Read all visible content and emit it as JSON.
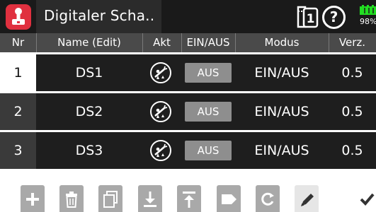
{
  "header": {
    "title": "Digitaler Scha..",
    "app_icon": "joystick-switch-icon",
    "model_icon": "model-memory-icon",
    "model_number": "1",
    "help_label": "?",
    "battery_percent": "98%",
    "accent_color": "#e0303f",
    "battery_color": "#22dd22"
  },
  "table": {
    "columns": [
      "Nr",
      "Name (Edit)",
      "Akt",
      "EIN/AUS",
      "Modus",
      "Verz."
    ],
    "rows": [
      {
        "nr": "1",
        "name": "DS1",
        "akt_icon": "control-assign-icon",
        "switch": "AUS",
        "mode": "EIN/AUS",
        "delay": "0.5"
      },
      {
        "nr": "2",
        "name": "DS2",
        "akt_icon": "control-assign-icon",
        "switch": "AUS",
        "mode": "EIN/AUS",
        "delay": "0.5"
      },
      {
        "nr": "3",
        "name": "DS3",
        "akt_icon": "control-assign-icon",
        "switch": "AUS",
        "mode": "EIN/AUS",
        "delay": "0.5"
      }
    ]
  },
  "toolbar": {
    "buttons": [
      "add-icon",
      "delete-icon",
      "copy-icon",
      "import-icon",
      "export-icon",
      "tag-icon",
      "reset-icon",
      "edit-icon"
    ],
    "confirm": "checkmark-icon"
  }
}
